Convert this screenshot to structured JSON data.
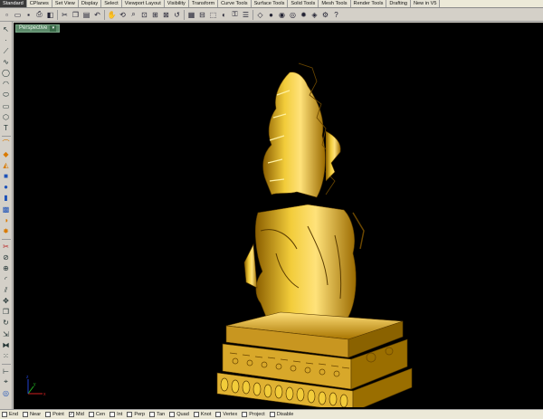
{
  "tabs": [
    {
      "label": "Standard",
      "active": true
    },
    {
      "label": "CPlanes"
    },
    {
      "label": "Set View"
    },
    {
      "label": "Display"
    },
    {
      "label": "Select"
    },
    {
      "label": "Viewport Layout"
    },
    {
      "label": "Visibility"
    },
    {
      "label": "Transform"
    },
    {
      "label": "Curve Tools"
    },
    {
      "label": "Surface Tools"
    },
    {
      "label": "Solid Tools"
    },
    {
      "label": "Mesh Tools"
    },
    {
      "label": "Render Tools"
    },
    {
      "label": "Drafting"
    },
    {
      "label": "New in V5"
    }
  ],
  "toolbar_icons": [
    {
      "name": "new-file-icon",
      "glyph": "▫"
    },
    {
      "name": "open-file-icon",
      "glyph": "▭"
    },
    {
      "name": "save-icon",
      "glyph": "▪"
    },
    {
      "name": "print-icon",
      "glyph": "⎙"
    },
    {
      "name": "layer-icon",
      "glyph": "◧"
    },
    {
      "name": "cut-icon",
      "glyph": "✂"
    },
    {
      "name": "copy-icon",
      "glyph": "❐"
    },
    {
      "name": "paste-icon",
      "glyph": "▤"
    },
    {
      "name": "undo-icon",
      "glyph": "↶"
    },
    {
      "name": "pan-icon",
      "glyph": "✋"
    },
    {
      "name": "rotate-view-icon",
      "glyph": "⟲"
    },
    {
      "name": "zoom-icon",
      "glyph": "⌕"
    },
    {
      "name": "zoom-window-icon",
      "glyph": "⊡"
    },
    {
      "name": "zoom-extents-icon",
      "glyph": "⊞"
    },
    {
      "name": "zoom-selected-icon",
      "glyph": "⊠"
    },
    {
      "name": "undo-view-icon",
      "glyph": "↺"
    },
    {
      "name": "four-views-icon",
      "glyph": "▦"
    },
    {
      "name": "cplane-icon",
      "glyph": "⊟"
    },
    {
      "name": "select-icon",
      "glyph": "⬚"
    },
    {
      "name": "hide-icon",
      "glyph": "◐"
    },
    {
      "name": "lock-icon",
      "glyph": "⚿"
    },
    {
      "name": "properties-icon",
      "glyph": "☰"
    },
    {
      "name": "wireframe-icon",
      "glyph": "◇"
    },
    {
      "name": "shaded-icon",
      "glyph": "●"
    },
    {
      "name": "rendered-icon",
      "glyph": "◉"
    },
    {
      "name": "render-icon",
      "glyph": "◎"
    },
    {
      "name": "lights-icon",
      "glyph": "✹"
    },
    {
      "name": "material-icon",
      "glyph": "◈"
    },
    {
      "name": "options-icon",
      "glyph": "⚙"
    },
    {
      "name": "help-icon",
      "glyph": "?"
    }
  ],
  "left_tools": [
    {
      "name": "select-arrow-icon",
      "glyph": "↖",
      "tone": ""
    },
    {
      "name": "point-icon",
      "glyph": "·",
      "tone": ""
    },
    {
      "name": "polyline-icon",
      "glyph": "⟋",
      "tone": ""
    },
    {
      "name": "curve-icon",
      "glyph": "∿",
      "tone": ""
    },
    {
      "name": "circle-icon",
      "glyph": "◯",
      "tone": ""
    },
    {
      "name": "arc-icon",
      "glyph": "◠",
      "tone": ""
    },
    {
      "name": "ellipse-icon",
      "glyph": "⬭",
      "tone": ""
    },
    {
      "name": "rectangle-icon",
      "glyph": "▭",
      "tone": ""
    },
    {
      "name": "polygon-icon",
      "glyph": "⬡",
      "tone": ""
    },
    {
      "name": "text-icon",
      "glyph": "T",
      "tone": ""
    },
    {
      "name": "sep1",
      "glyph": "",
      "tone": "sep"
    },
    {
      "name": "extrude-curve-icon",
      "glyph": "⌒",
      "tone": "orange"
    },
    {
      "name": "surface-icon",
      "glyph": "◆",
      "tone": "orange"
    },
    {
      "name": "loft-icon",
      "glyph": "◭",
      "tone": "orange"
    },
    {
      "name": "box-icon",
      "glyph": "■",
      "tone": "blue"
    },
    {
      "name": "sphere-icon",
      "glyph": "●",
      "tone": "blue"
    },
    {
      "name": "cylinder-icon",
      "glyph": "▮",
      "tone": "blue"
    },
    {
      "name": "mesh-icon",
      "glyph": "▩",
      "tone": "blue"
    },
    {
      "name": "boolean-icon",
      "glyph": "◑",
      "tone": "orange"
    },
    {
      "name": "explode-icon",
      "glyph": "✸",
      "tone": "orange"
    },
    {
      "name": "sep2",
      "glyph": "",
      "tone": "sep"
    },
    {
      "name": "trim-icon",
      "glyph": "✂",
      "tone": "red"
    },
    {
      "name": "split-icon",
      "glyph": "⊘",
      "tone": ""
    },
    {
      "name": "join-icon",
      "glyph": "⊕",
      "tone": ""
    },
    {
      "name": "fillet-icon",
      "glyph": "◜",
      "tone": ""
    },
    {
      "name": "offset-icon",
      "glyph": "⫽",
      "tone": ""
    },
    {
      "name": "move-icon",
      "glyph": "✥",
      "tone": ""
    },
    {
      "name": "copy-tool-icon",
      "glyph": "❐",
      "tone": ""
    },
    {
      "name": "rotate-icon",
      "glyph": "↻",
      "tone": ""
    },
    {
      "name": "scale-icon",
      "glyph": "⇲",
      "tone": ""
    },
    {
      "name": "mirror-icon",
      "glyph": "⧓",
      "tone": ""
    },
    {
      "name": "array-icon",
      "glyph": "⁙",
      "tone": ""
    },
    {
      "name": "sep3",
      "glyph": "",
      "tone": "sep"
    },
    {
      "name": "dimension-icon",
      "glyph": "⊢",
      "tone": ""
    },
    {
      "name": "analyze-icon",
      "glyph": "⌖",
      "tone": ""
    },
    {
      "name": "render-tool-icon",
      "glyph": "◎",
      "tone": "blue"
    }
  ],
  "viewport": {
    "label": "Perspective",
    "background": "#000000",
    "model_color": "#e0b41a"
  },
  "axes": {
    "x": "x",
    "y": "y",
    "z": "z"
  },
  "osnaps": [
    {
      "label": "End",
      "checked": false
    },
    {
      "label": "Near",
      "checked": false
    },
    {
      "label": "Point",
      "checked": false
    },
    {
      "label": "Mid",
      "checked": true
    },
    {
      "label": "Cen",
      "checked": false
    },
    {
      "label": "Int",
      "checked": false
    },
    {
      "label": "Perp",
      "checked": false
    },
    {
      "label": "Tan",
      "checked": false
    },
    {
      "label": "Quad",
      "checked": false
    },
    {
      "label": "Knot",
      "checked": false
    },
    {
      "label": "Vertex",
      "checked": false
    },
    {
      "label": "Project",
      "checked": false
    },
    {
      "label": "Disable",
      "checked": false
    }
  ]
}
